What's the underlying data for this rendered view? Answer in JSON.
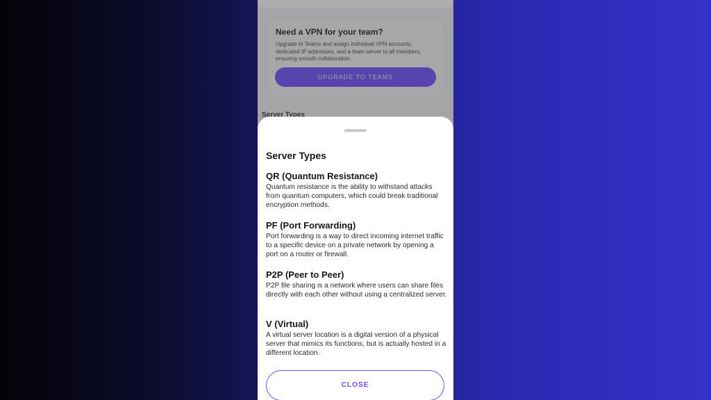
{
  "background_screen": {
    "teams_card": {
      "title": "Need a VPN for your team?",
      "description": "Upgrade to Teams and assign individual VPN accounts, dedicated IP addresses, and a team server to all members, ensuring smooth collaboration.",
      "upgrade_button": "UPGRADE TO TEAMS"
    },
    "section_title": "Server Types"
  },
  "sheet": {
    "title": "Server Types",
    "types": [
      {
        "name": "QR (Quantum Resistance)",
        "description": "Quantum resistance is the ability to withstand attacks from quantum computers, which could break traditional encryption methods."
      },
      {
        "name": "PF (Port Forwarding)",
        "description": "Port forwarding is a way to direct incoming internet traffic to a specific device on a private network by opening a port on a router or firewall."
      },
      {
        "name": "P2P (Peer to Peer)",
        "description": "P2P file sharing is a network where users can share files directly with each other without using a centralized server."
      },
      {
        "name": "V (Virtual)",
        "description": "A virtual server location is a digital version of a physical server that mimics its functions, but is actually hosted in a different location."
      }
    ],
    "close_button": "CLOSE"
  },
  "colors": {
    "accent": "#6d4aff",
    "scrim": "rgba(60,60,60,0.42)",
    "sheet_background": "#ffffff"
  }
}
